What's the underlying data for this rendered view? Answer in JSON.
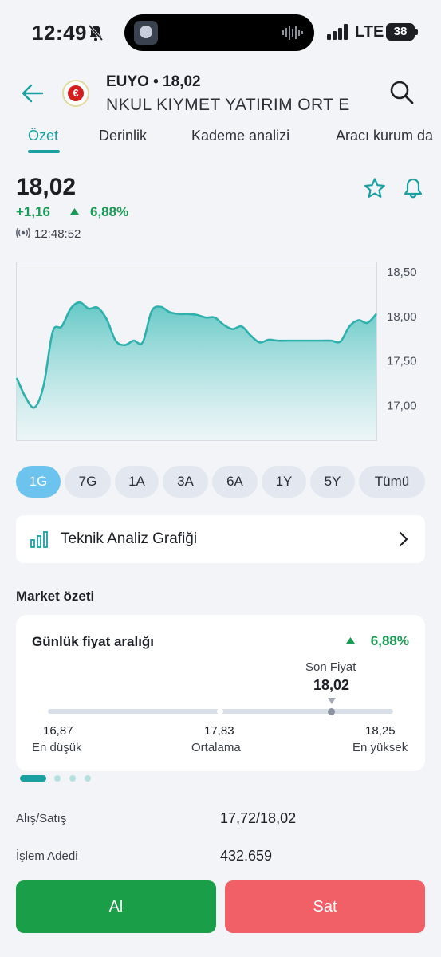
{
  "status_bar": {
    "time": "12:49",
    "network": "LTE",
    "battery": "38",
    "icons": [
      "bell-slash-icon",
      "signal-bars-icon",
      "battery-icon",
      "audio-waveform-icon"
    ]
  },
  "header": {
    "ticker_line": "EUYO • 18,02",
    "company_name": "NKUL KIYMET YATIRIM ORT     E",
    "logo_glyph": "€",
    "icons": [
      "back-arrow-icon",
      "search-icon"
    ]
  },
  "tabs": [
    {
      "label": "Özet",
      "active": true
    },
    {
      "label": "Derinlik",
      "active": false
    },
    {
      "label": "Kademe analizi",
      "active": false
    },
    {
      "label": "Aracı kurum da",
      "active": false
    }
  ],
  "price_block": {
    "price": "18,02",
    "change_abs": "+1,16",
    "change_pct": "6,88%",
    "update_time": "12:48:52",
    "icons": [
      "star-icon",
      "bell-icon",
      "live-broadcast-icon"
    ]
  },
  "colors": {
    "accent": "#1aa0a0",
    "positive": "#1a9a55",
    "buy": "#1a9e48",
    "sell": "#f06066",
    "range_active": "#6cc3ee"
  },
  "chart_data": {
    "type": "area",
    "x": [
      0,
      1,
      2,
      3,
      4,
      5,
      6,
      7,
      8,
      9,
      10,
      11,
      12,
      13,
      14,
      15,
      16,
      17,
      18,
      19,
      20,
      21,
      22,
      23,
      24,
      25,
      26,
      27,
      28,
      29,
      30,
      31,
      32,
      33,
      34,
      35,
      36,
      37,
      38,
      39,
      40
    ],
    "y": [
      17.3,
      17.08,
      16.97,
      17.22,
      17.82,
      17.88,
      18.08,
      18.15,
      18.08,
      18.09,
      17.96,
      17.72,
      17.67,
      17.72,
      17.7,
      18.05,
      18.1,
      18.04,
      18.02,
      18.02,
      18.01,
      17.98,
      17.98,
      17.9,
      17.85,
      17.88,
      17.78,
      17.7,
      17.73,
      17.72,
      17.72,
      17.72,
      17.72,
      17.72,
      17.72,
      17.72,
      17.71,
      17.88,
      17.95,
      17.92,
      18.02
    ],
    "ylim": [
      16.6,
      18.6
    ],
    "yticks": [
      "18,50",
      "18,00",
      "17,50",
      "17,00"
    ],
    "ytick_values": [
      18.5,
      18.0,
      17.5,
      17.0
    ],
    "axis_side": "right",
    "grid": false
  },
  "ranges": [
    {
      "label": "1G",
      "active": true
    },
    {
      "label": "7G",
      "active": false
    },
    {
      "label": "1A",
      "active": false
    },
    {
      "label": "3A",
      "active": false
    },
    {
      "label": "6A",
      "active": false
    },
    {
      "label": "1Y",
      "active": false
    },
    {
      "label": "5Y",
      "active": false
    },
    {
      "label": "Tümü",
      "active": false
    }
  ],
  "technical_analysis": {
    "label": "Teknik Analiz Grafiği",
    "icons": [
      "bar-chart-icon",
      "chevron-right-icon"
    ]
  },
  "market_summary": {
    "title": "Market özeti",
    "daily_range": {
      "title": "Günlük fiyat aralığı",
      "change_pct": "6,88%",
      "last_label": "Son Fiyat",
      "last_value": "18,02",
      "low_value": "16,87",
      "low_label": "En düşük",
      "avg_value": "17,83",
      "avg_label": "Ortalama",
      "high_value": "18,25",
      "high_label": "En yüksek",
      "last_position_fraction": 0.83
    },
    "pager": {
      "pages": 4,
      "active": 1
    }
  },
  "info": [
    {
      "label": "Alış/Satış",
      "value": "17,72/18,02"
    },
    {
      "label": "İşlem Adedi",
      "value": "432.659"
    }
  ],
  "actions": {
    "buy": "Al",
    "sell": "Sat"
  }
}
